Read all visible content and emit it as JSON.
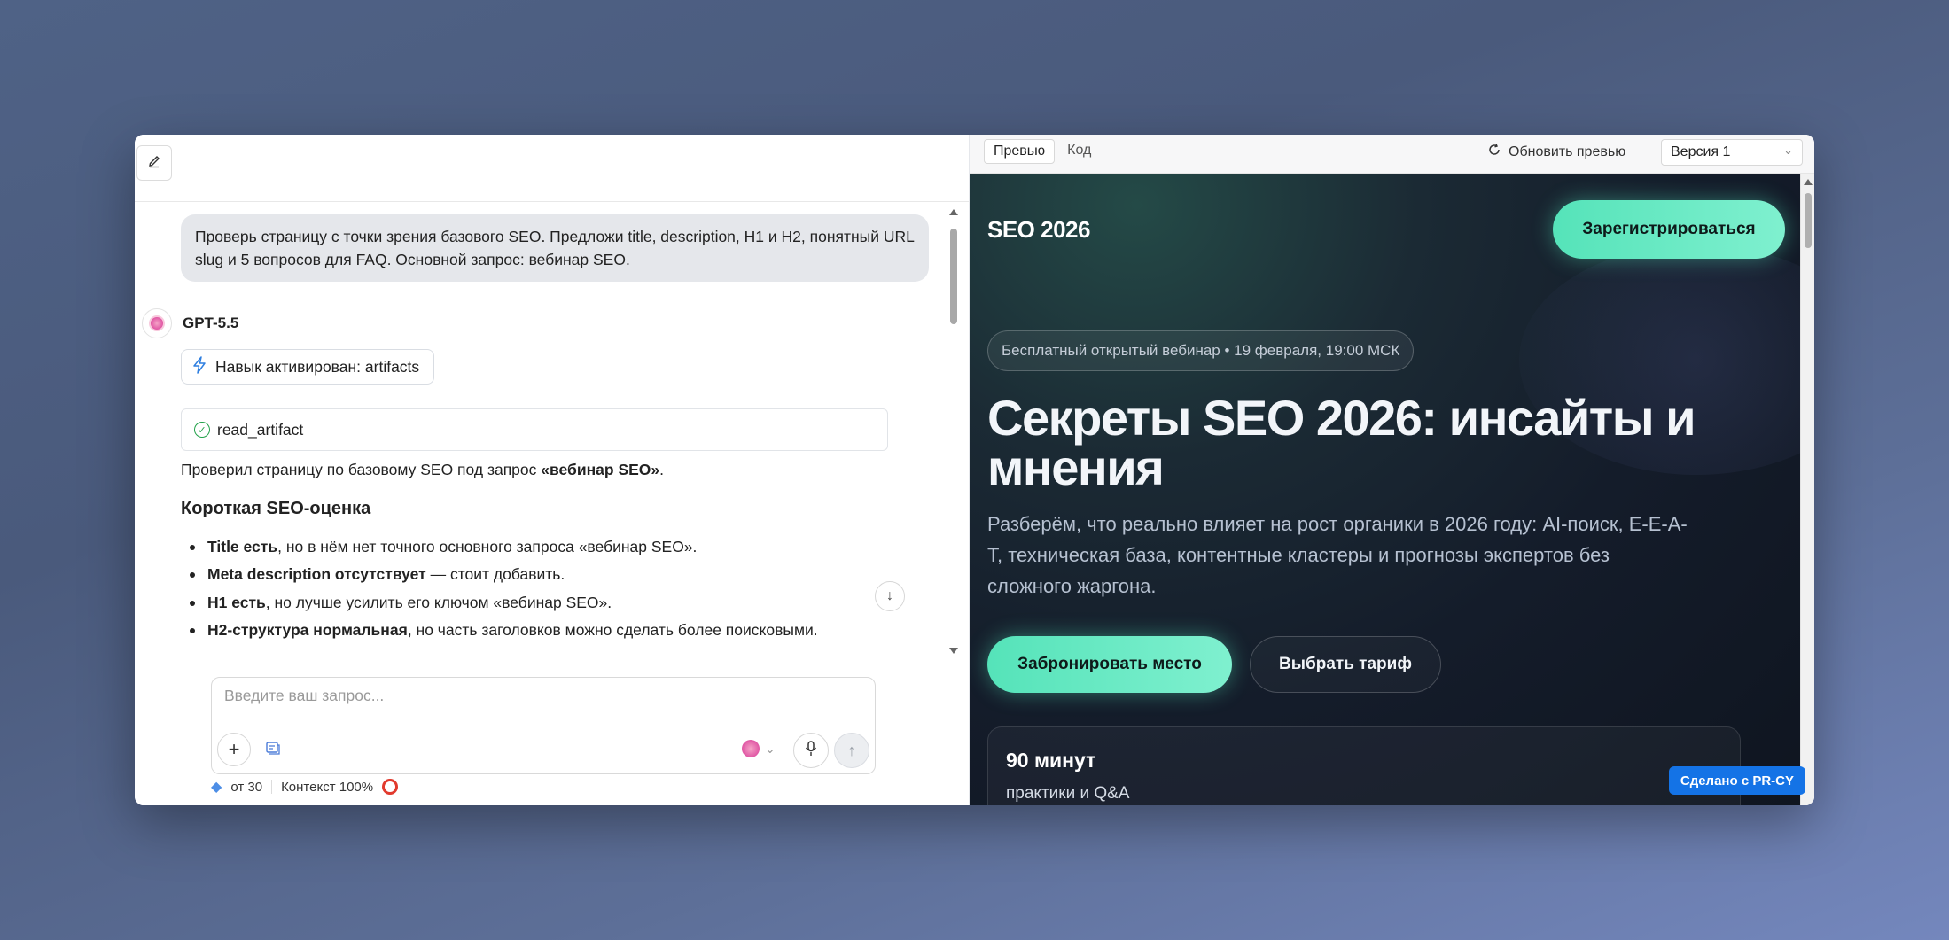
{
  "chat": {
    "user_message": "Проверь страницу с точки зрения базового SEO. Предложи title, description, H1 и H2, понятный URL slug и 5 вопросов для FAQ. Основной запрос: вебинар SEO.",
    "bot_name": "GPT-5.5",
    "skill_chip": "Навык активирован: artifacts",
    "tool_call": "read_artifact",
    "intro_before": "Проверил страницу по базовому SEO под запрос ",
    "intro_bold": "«вебинар SEO»",
    "intro_after": ".",
    "heading": "Короткая SEO-оценка",
    "bullets": [
      {
        "bold": "Title есть",
        "rest": ", но в нём нет точного основного запроса «вебинар SEO»."
      },
      {
        "bold": "Meta description отсутствует",
        "rest": " — стоит добавить."
      },
      {
        "bold": "H1 есть",
        "rest": ", но лучше усилить его ключом «вебинар SEO»."
      },
      {
        "bold": "H2-структура нормальная",
        "rest": ", но часть заголовков можно сделать более поисковыми."
      }
    ],
    "input_placeholder": "Введите ваш запрос...",
    "credits": "от 30",
    "context": "Контекст 100%"
  },
  "preview_panel": {
    "tab_preview": "Превью",
    "tab_code": "Код",
    "refresh": "Обновить превью",
    "version": "Версия 1"
  },
  "site": {
    "logo": "SEO 2026",
    "register": "Зарегистрироваться",
    "badge": "Бесплатный открытый вебинар • 19 февраля, 19:00 МСК",
    "h1": "Секреты SEO 2026: инсайты и мнения",
    "subtitle": "Разберём, что реально влияет на рост органики в 2026 году: AI-поиск, E-E-A-T, техническая база, контентные кластеры и прогнозы экспертов без сложного жаргона.",
    "btn_book": "Забронировать место",
    "btn_tariff": "Выбрать тариф",
    "card_big": "90 минут",
    "card_small": "практики и Q&A",
    "made_with": "Сделано с PR-CY"
  },
  "icons": {
    "edit": "edit-icon",
    "lightning": "lightning-icon",
    "check": "check-circle-icon",
    "arrow_down": "arrow-down-icon",
    "plus": "plus-icon",
    "prompt": "prompt-library-icon",
    "mic": "mic-icon",
    "send": "send-arrow-icon",
    "refresh": "refresh-icon",
    "gem": "gem-icon"
  },
  "colors": {
    "accent_green": "#5ee6bd",
    "made_with_blue": "#1473e6",
    "context_ring": "#e23a2e"
  }
}
